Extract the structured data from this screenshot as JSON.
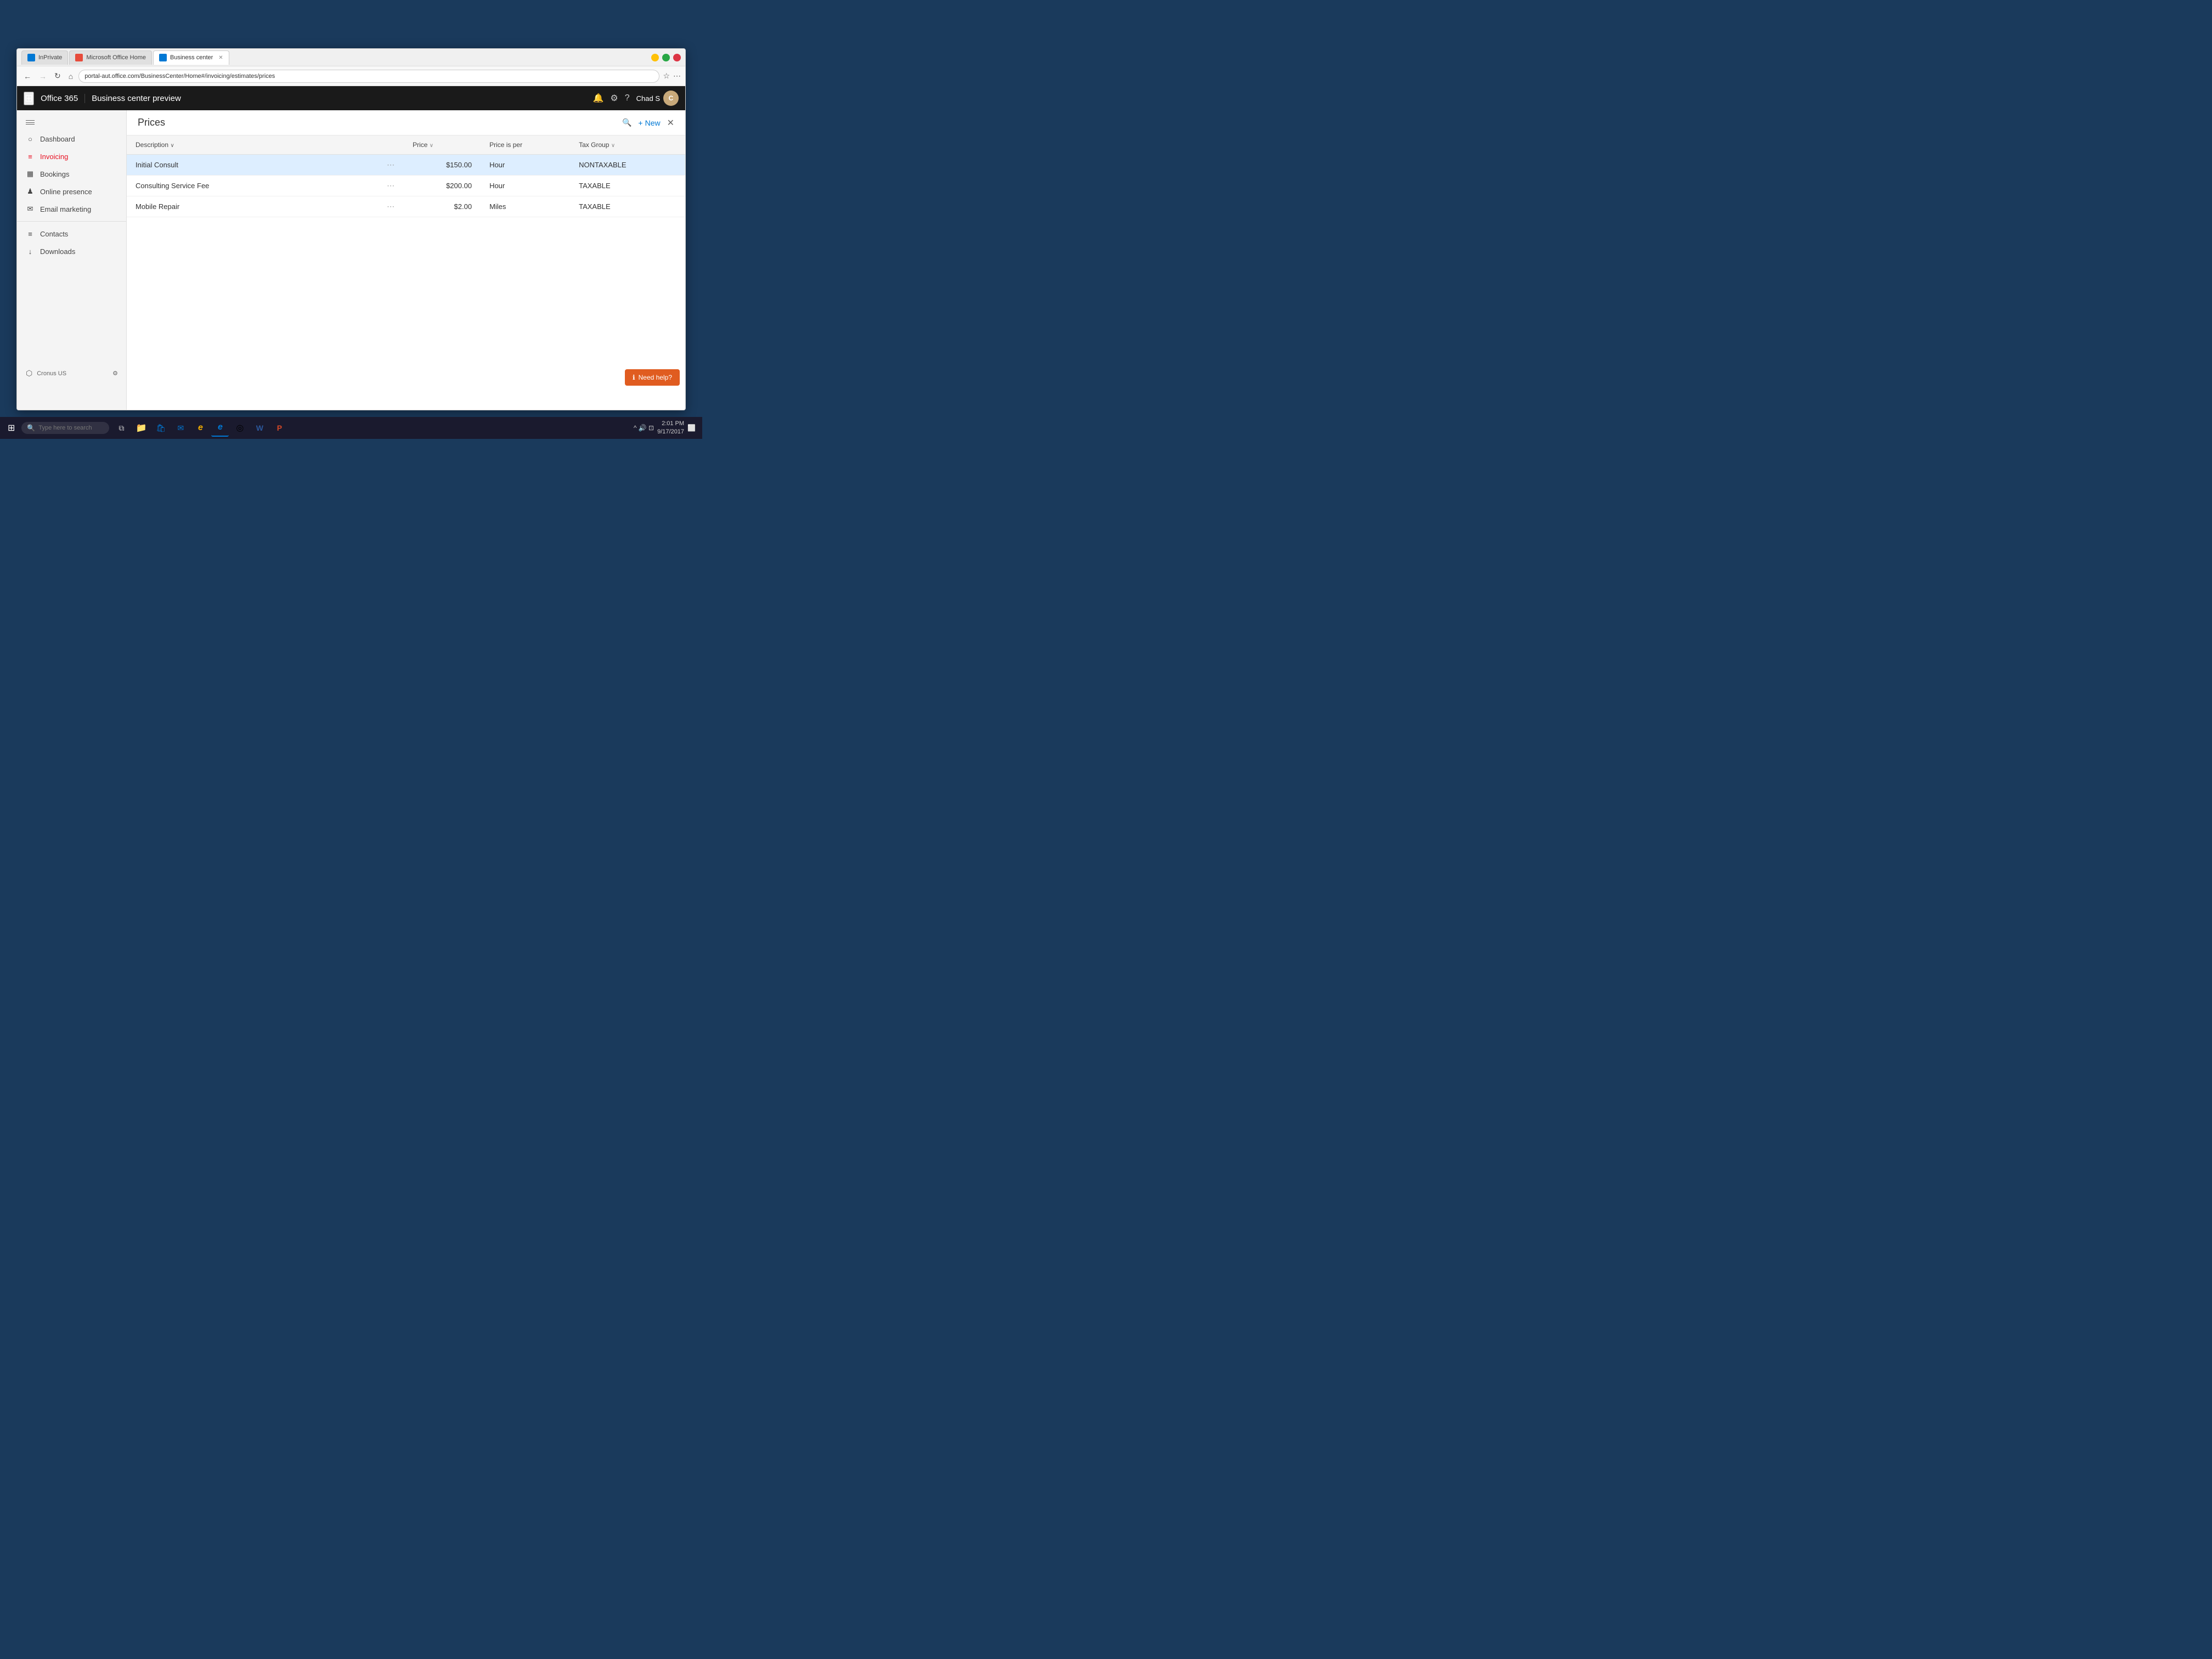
{
  "browser": {
    "tabs": [
      {
        "id": "inprivate",
        "label": "InPrivate",
        "active": false
      },
      {
        "id": "msoffice",
        "label": "Microsoft Office Home",
        "active": false
      },
      {
        "id": "business",
        "label": "Business center",
        "active": true
      }
    ],
    "address": "portal-aut.office.com/BusinessCenter/Home#/invoicing/estimates/prices"
  },
  "o365": {
    "brand": "Office 365",
    "app_name": "Business center preview",
    "user": "Chad S"
  },
  "sidebar": {
    "menu_label": "Menu",
    "items": [
      {
        "id": "dashboard",
        "label": "Dashboard",
        "icon": "○"
      },
      {
        "id": "invoicing",
        "label": "Invoicing",
        "icon": "≡",
        "active": true
      },
      {
        "id": "bookings",
        "label": "Bookings",
        "icon": "▦"
      },
      {
        "id": "online-presence",
        "label": "Online presence",
        "icon": "♟"
      },
      {
        "id": "email-marketing",
        "label": "Email marketing",
        "icon": "✉"
      }
    ],
    "secondary_items": [
      {
        "id": "contacts",
        "label": "Contacts",
        "icon": "≡"
      },
      {
        "id": "downloads",
        "label": "Downloads",
        "icon": "↓"
      }
    ],
    "bottom_label": "Cronus US",
    "bottom_icon": "⚙"
  },
  "prices": {
    "title": "Prices",
    "new_button": "New",
    "columns": {
      "description": "Description",
      "price": "Price",
      "price_is_per": "Price is per",
      "tax_group": "Tax Group"
    },
    "rows": [
      {
        "description": "Initial Consult",
        "price": "$150.00",
        "price_per": "Hour",
        "tax_group": "NONTAXABLE",
        "selected": true
      },
      {
        "description": "Consulting Service Fee",
        "price": "$200.00",
        "price_per": "Hour",
        "tax_group": "TAXABLE",
        "selected": false
      },
      {
        "description": "Mobile Repair",
        "price": "$2.00",
        "price_per": "Miles",
        "tax_group": "TAXABLE",
        "selected": false
      }
    ]
  },
  "need_help": {
    "label": "Need help?",
    "icon": "ℹ"
  },
  "taskbar": {
    "search_placeholder": "Type here to search",
    "time": "2:01 PM",
    "date": "9/17/2017",
    "apps": [
      {
        "id": "start",
        "label": "Start",
        "icon": "⊞"
      },
      {
        "id": "search",
        "label": "Search"
      },
      {
        "id": "task",
        "label": "Task View",
        "icon": "⧉"
      },
      {
        "id": "explorer",
        "label": "File Explorer",
        "icon": "📁"
      },
      {
        "id": "store",
        "label": "Store",
        "icon": "🛍"
      },
      {
        "id": "mail",
        "label": "Mail",
        "icon": "✉"
      },
      {
        "id": "ie",
        "label": "Internet Explorer",
        "icon": "e"
      },
      {
        "id": "edge",
        "label": "Microsoft Edge",
        "icon": "e"
      },
      {
        "id": "chrome",
        "label": "Chrome",
        "icon": "◎"
      },
      {
        "id": "word",
        "label": "Word",
        "icon": "W"
      },
      {
        "id": "ppt",
        "label": "PowerPoint",
        "icon": "P"
      }
    ]
  }
}
